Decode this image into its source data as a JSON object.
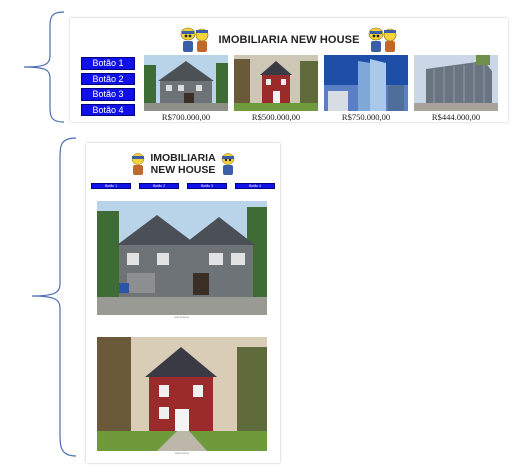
{
  "site": {
    "title": "IMOBILIARIA NEW HOUSE",
    "title_line1": "IMOBILIARIA",
    "title_line2": "NEW HOUSE"
  },
  "buttons": [
    "Botão 1",
    "Botão 2",
    "Botão 3",
    "Botão 4"
  ],
  "listings": [
    {
      "price": "R$700.000,00",
      "kind": "gray-craftsman-house"
    },
    {
      "price": "R$500.000,00",
      "kind": "red-house"
    },
    {
      "price": "R$750.000,00",
      "kind": "glass-tower"
    },
    {
      "price": "R$444.000,00",
      "kind": "office-building"
    }
  ],
  "icons": {
    "brace": "curly-brace-icon",
    "mascot": "mascot-icon"
  },
  "colors": {
    "button_blue": "#1010e8",
    "brace_blue": "#4a6fb0"
  }
}
